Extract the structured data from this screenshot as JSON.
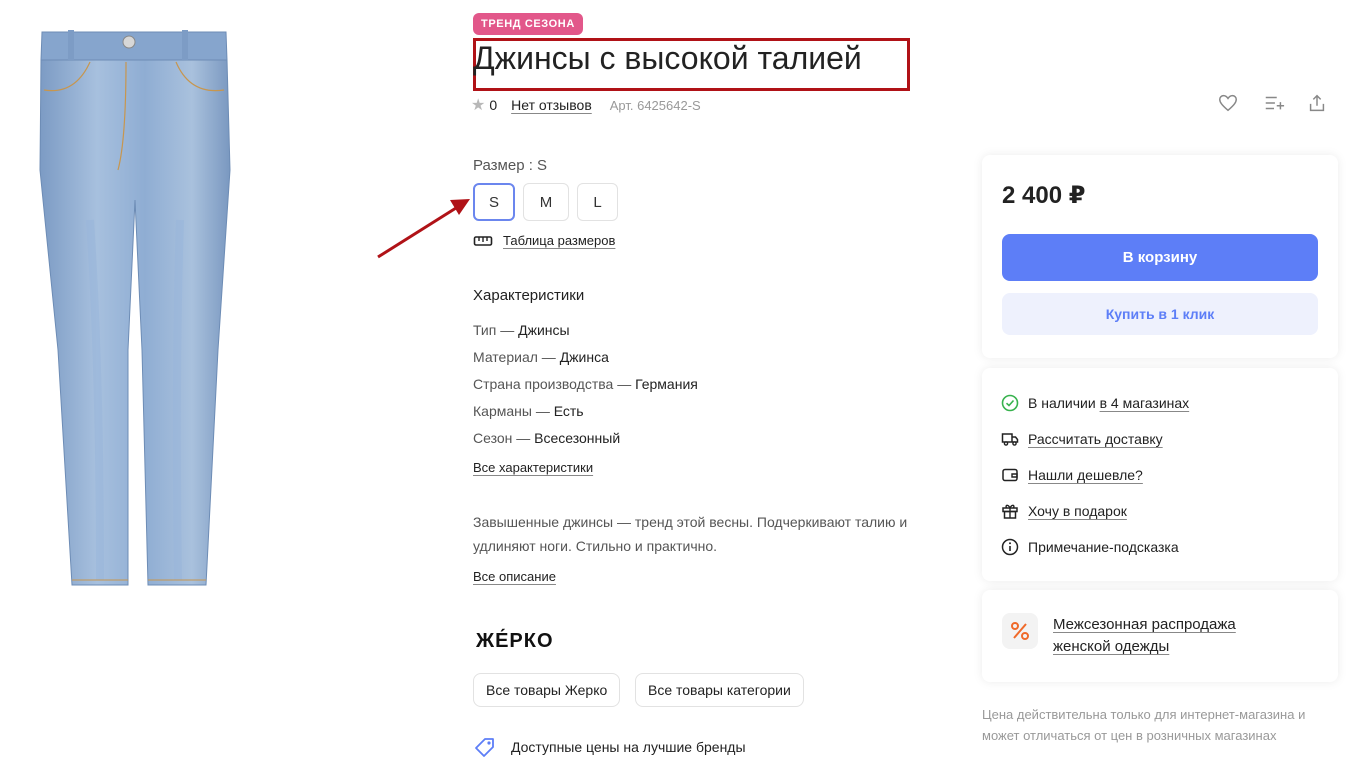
{
  "badge": "ТРЕНД СЕЗОНА",
  "product": {
    "title": "Джинсы с высокой талией",
    "rating": "0",
    "reviews_link": "Нет отзывов",
    "sku": "Арт. 6425642-S"
  },
  "sizes": {
    "label": "Размер : S",
    "options": [
      "S",
      "M",
      "L"
    ],
    "selected": "S",
    "table_link": "Таблица размеров"
  },
  "characteristics": {
    "title": "Характеристики",
    "items": [
      {
        "name": "Тип",
        "value": "Джинсы"
      },
      {
        "name": "Материал",
        "value": "Джинса"
      },
      {
        "name": "Страна производства",
        "value": "Германия"
      },
      {
        "name": "Карманы",
        "value": "Есть"
      },
      {
        "name": "Сезон",
        "value": "Всесезонный"
      }
    ],
    "all_link": "Все характеристики"
  },
  "description": {
    "text": "Завышенные джинсы — тренд этой весны. Подчеркивают талию и удлиняют ноги. Стильно и практично.",
    "all_link": "Все описание"
  },
  "brand": {
    "logo_text": "ЖЕ́РКО",
    "all_brand_button": "Все товары Жерко",
    "all_category_button": "Все товары категории",
    "promo": "Доступные цены на лучшие бренды"
  },
  "purchase": {
    "price": "2 400 ₽",
    "cart_button": "В корзину",
    "one_click_button": "Купить в 1 клик"
  },
  "info": {
    "availability_prefix": "В наличии ",
    "availability_link": "в 4 магазинах",
    "delivery_link": "Рассчитать доставку",
    "cheaper_link": "Нашли дешевле?",
    "gift_link": "Хочу в подарок",
    "hint": "Примечание-подсказка"
  },
  "sale": {
    "text": "Межсезонная распродажа женской одежды"
  },
  "price_note": "Цена действительна только для интернет-магазина и может отличаться от цен в розничных магазинах",
  "colors": {
    "accent": "#5d7ef7",
    "badge": "#e2578a",
    "annotation": "#b01217",
    "available": "#37b24d",
    "sale_icon": "#f06a2a"
  }
}
